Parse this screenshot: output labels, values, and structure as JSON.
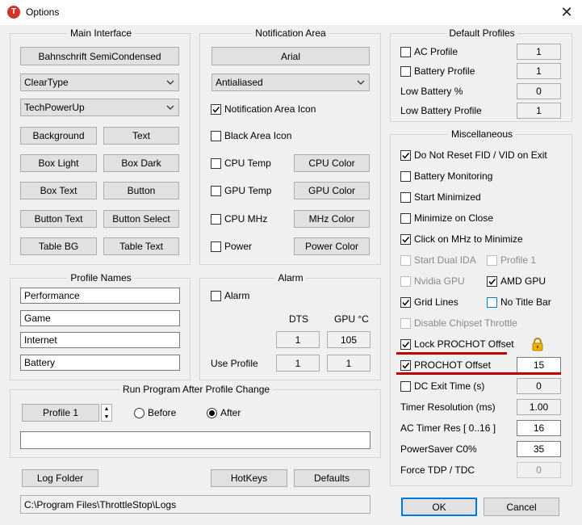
{
  "window": {
    "title": "Options",
    "app_icon_letter": "T"
  },
  "main_interface": {
    "title": "Main Interface",
    "font_button": "Bahnschrift SemiCondensed",
    "render_mode": "ClearType",
    "theme": "TechPowerUp",
    "color_buttons": [
      "Background",
      "Text",
      "Box Light",
      "Box Dark",
      "Box Text",
      "Button",
      "Button Text",
      "Button Select",
      "Table BG",
      "Table Text"
    ]
  },
  "notification_area": {
    "title": "Notification Area",
    "font_button": "Arial",
    "smoothing": "Antialiased",
    "notification_area_icon": "Notification Area Icon",
    "black_area_icon": "Black Area Icon",
    "cpu_temp": "CPU Temp",
    "cpu_color": "CPU Color",
    "gpu_temp": "GPU Temp",
    "gpu_color": "GPU Color",
    "cpu_mhz": "CPU MHz",
    "mhz_color": "MHz Color",
    "power": "Power",
    "power_color": "Power Color"
  },
  "default_profiles": {
    "title": "Default Profiles",
    "ac_profile": {
      "label": "AC Profile",
      "value": "1"
    },
    "battery_profile": {
      "label": "Battery Profile",
      "value": "1"
    },
    "low_battery": {
      "label": "Low Battery %",
      "value": "0"
    },
    "low_battery_profile": {
      "label": "Low Battery Profile",
      "value": "1"
    }
  },
  "miscellaneous": {
    "title": "Miscellaneous",
    "do_not_reset": "Do Not Reset FID / VID on Exit",
    "battery_monitoring": "Battery Monitoring",
    "start_minimized": "Start Minimized",
    "minimize_on_close": "Minimize on Close",
    "click_mhz": "Click on MHz to Minimize",
    "start_dual_ida": "Start Dual IDA",
    "profile_1": "Profile 1",
    "nvidia_gpu": "Nvidia GPU",
    "amd_gpu": "AMD GPU",
    "grid_lines": "Grid Lines",
    "no_title_bar": "No Title Bar",
    "disable_chipset": "Disable Chipset Throttle",
    "lock_prochot": "Lock PROCHOT Offset",
    "prochot_offset": {
      "label": "PROCHOT Offset",
      "value": "15"
    },
    "dc_exit_time": {
      "label": "DC Exit Time (s)",
      "value": "0"
    },
    "timer_resolution": {
      "label": "Timer Resolution (ms)",
      "value": "1.00"
    },
    "ac_timer_res": {
      "label": "AC Timer Res [ 0..16 ]",
      "value": "16"
    },
    "powersaver": {
      "label": "PowerSaver C0%",
      "value": "35"
    },
    "force_tdp": {
      "label": "Force TDP / TDC",
      "value": "0"
    }
  },
  "profile_names": {
    "title": "Profile Names",
    "names": [
      "Performance",
      "Game",
      "Internet",
      "Battery"
    ]
  },
  "alarm": {
    "title": "Alarm",
    "alarm_label": "Alarm",
    "dts_header": "DTS",
    "gpu_header": "GPU °C",
    "dts_value": "1",
    "gpu_value": "105",
    "use_profile_label": "Use Profile",
    "use_profile_dts": "1",
    "use_profile_gpu": "1"
  },
  "run_program": {
    "title": "Run Program After Profile Change",
    "profile_button": "Profile 1",
    "before": "Before",
    "after": "After",
    "path": ""
  },
  "bottom": {
    "log_folder": "Log Folder",
    "hotkeys": "HotKeys",
    "defaults": "Defaults",
    "log_path": "C:\\Program Files\\ThrottleStop\\Logs",
    "ok": "OK",
    "cancel": "Cancel"
  },
  "colors": {
    "highlight_line": "#c00000",
    "focus_border": "#0078d7",
    "lock_icon": "#d8a000"
  }
}
